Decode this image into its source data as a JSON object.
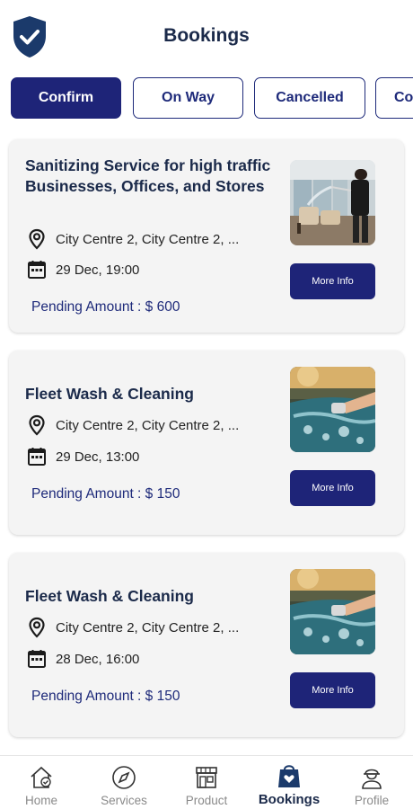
{
  "header": {
    "title": "Bookings"
  },
  "tabs": [
    {
      "label": "Confirm",
      "active": true
    },
    {
      "label": "On Way",
      "active": false
    },
    {
      "label": "Cancelled",
      "active": false
    },
    {
      "label": "Co",
      "active": false
    }
  ],
  "bookings": [
    {
      "title": "Sanitizing Service for high traffic Businesses, Offices, and Stores",
      "location": "City Centre 2, City Centre 2, ...",
      "datetime": "29 Dec, 19:00",
      "pending": "Pending Amount : $ 600",
      "button": "More Info",
      "image": "sanitizing-photo"
    },
    {
      "title": "Fleet Wash & Cleaning",
      "location": "City Centre 2, City Centre 2, ...",
      "datetime": "29 Dec, 13:00",
      "pending": "Pending Amount : $ 150",
      "button": "More Info",
      "image": "car-wash-photo"
    },
    {
      "title": "Fleet Wash & Cleaning",
      "location": "City Centre 2, City Centre 2, ...",
      "datetime": "28 Dec, 16:00",
      "pending": "Pending Amount : $ 150",
      "button": "More Info",
      "image": "car-wash-photo"
    }
  ],
  "nav": [
    {
      "label": "Home",
      "icon": "home-check-icon",
      "active": false
    },
    {
      "label": "Services",
      "icon": "compass-icon",
      "active": false
    },
    {
      "label": "Product",
      "icon": "storefront-icon",
      "active": false
    },
    {
      "label": "Bookings",
      "icon": "shopping-bag-heart-icon",
      "active": true
    },
    {
      "label": "Profile",
      "icon": "worker-icon",
      "active": false
    }
  ],
  "colors": {
    "primary": "#1e2478",
    "title": "#1b2a4a",
    "card": "#f4f4f4",
    "muted": "#8a8a8a"
  }
}
